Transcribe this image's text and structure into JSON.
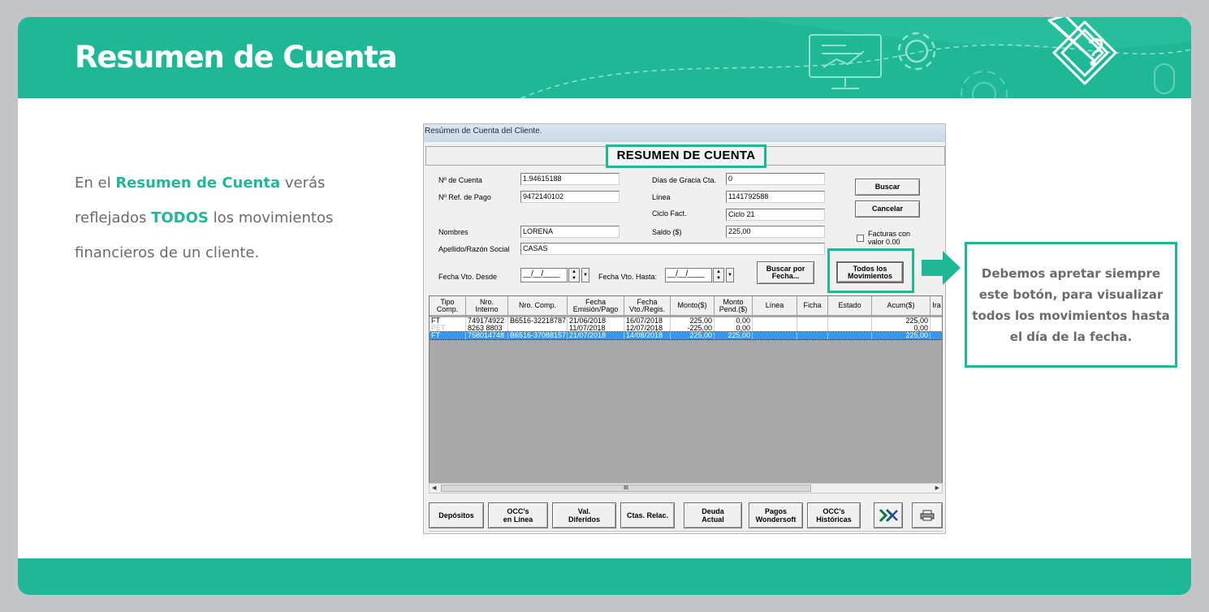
{
  "slide": {
    "title": "Resumen de Cuenta",
    "intro_parts": [
      "En el ",
      "Resumen de Cuenta",
      " verás reflejados ",
      "TODOS",
      " los movimientos financieros de un cliente."
    ],
    "callout": "Debemos apretar siempre este botón, para visualizar todos los movimientos hasta el día de la fecha.",
    "colors": {
      "accent": "#1fb897",
      "background": "#c2c4c6",
      "text": "#6b6b6b"
    }
  },
  "window": {
    "title": "Resúmen de Cuenta del Cliente.",
    "banner": "RESUMEN DE CUENTA"
  },
  "form": {
    "nro_cuenta": {
      "label": "Nº de Cuenta",
      "value": "1.94615188"
    },
    "nro_ref_pago": {
      "label": "Nº Ref. de Pago",
      "value": "9472140102"
    },
    "nombres": {
      "label": "Nombres",
      "value": "LORENA"
    },
    "apellido": {
      "label": "Apellido/Razón Social",
      "value": "CASAS"
    },
    "dias_gracia": {
      "label": "Días de Gracia Cta.",
      "value": "0"
    },
    "linea": {
      "label": "Línea",
      "value": "1141792588"
    },
    "ciclo_fact": {
      "label": "Ciclo Fact.",
      "value": "Ciclo 21"
    },
    "saldo": {
      "label": "Saldo ($)",
      "value": "225,00"
    },
    "fecha_desde": {
      "label": "Fecha Vto. Desde",
      "value": "__/__/____"
    },
    "fecha_hasta": {
      "label": "Fecha Vto. Hasta:",
      "value": "__/__/____"
    },
    "facturas_con_valor": {
      "label_line1": "Facturas con",
      "label_line2": "valor 0.00",
      "checked": false
    }
  },
  "buttons": {
    "buscar": "Buscar",
    "cancelar": "Cancelar",
    "buscar_por_fecha_l1": "Buscar por",
    "buscar_por_fecha_l2": "Fecha...",
    "todos_mov_l1": "Todos los",
    "todos_mov_l2": "Movimientos"
  },
  "table": {
    "columns": [
      [
        "Tipo",
        "Comp."
      ],
      [
        "Nro.",
        "Interno"
      ],
      [
        "Nro. Comp.",
        ""
      ],
      [
        "Fecha",
        "Emisión/Pago"
      ],
      [
        "Fecha",
        "Vto./Regis."
      ],
      [
        "Monto($)",
        ""
      ],
      [
        "Monto",
        "Pend.($)"
      ],
      [
        "Línea",
        ""
      ],
      [
        "Ficha",
        ""
      ],
      [
        "Estado",
        ""
      ],
      [
        "Acum($)",
        ""
      ],
      [
        "Ira",
        ""
      ]
    ],
    "rows": [
      [
        "FT",
        "749174922",
        "B6516-32218787",
        "21/06/2018",
        "16/07/2018",
        "225,00",
        "0,00",
        "",
        "",
        "",
        "225,00"
      ],
      [
        "PET",
        "8263 8803",
        "",
        "11/07/2018",
        "12/07/2018",
        "-225,00",
        "0,00",
        "",
        "",
        "",
        "0,00"
      ],
      [
        "FT",
        "758014748",
        "B6516-37088157",
        "21/07/2018",
        "14/08/2018",
        "225,00",
        "225,00",
        "",
        "",
        "",
        "225,00"
      ]
    ],
    "selected_row": 2,
    "scroll_thumb": "III"
  },
  "bottom_buttons": [
    [
      "Depósitos",
      ""
    ],
    [
      "OCC's",
      "en Línea"
    ],
    [
      "Val.",
      "Diferidos"
    ],
    [
      "Ctas. Relac.",
      ""
    ],
    [
      "Deuda",
      "Actual"
    ],
    [
      "Pagos",
      "Wondersoft"
    ],
    [
      "OCC's",
      "Históricas"
    ]
  ],
  "icons": [
    "excel-export-icon",
    "printer-icon",
    "gear-icon",
    "presentation-icon",
    "pencil-logo-icon",
    "arrow-right-icon"
  ]
}
